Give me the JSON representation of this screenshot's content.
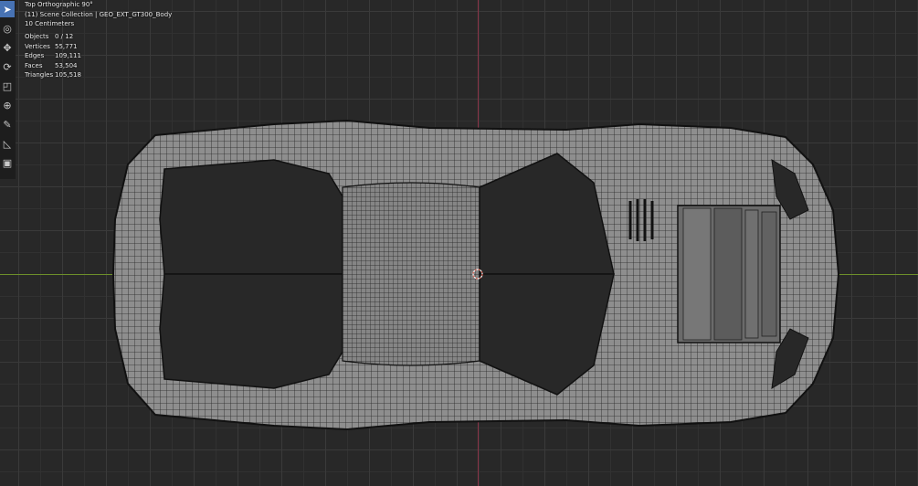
{
  "viewport": {
    "view_name": "Top Orthographic 90°",
    "collection": "(11) Scene Collection | GEO_EXT_GT300_Body",
    "scale": "10 Centimeters"
  },
  "stats": [
    {
      "label": "Objects",
      "value": "0 / 12"
    },
    {
      "label": "Vertices",
      "value": "55,771"
    },
    {
      "label": "Edges",
      "value": "109,111"
    },
    {
      "label": "Faces",
      "value": "53,504"
    },
    {
      "label": "Triangles",
      "value": "105,518"
    }
  ],
  "toolbar": [
    {
      "name": "select-tool",
      "icon": "cursor-arrow-icon",
      "glyph": "➤",
      "active": true
    },
    {
      "name": "cursor-tool",
      "icon": "3d-cursor-icon",
      "glyph": "◎",
      "active": false
    },
    {
      "name": "move-tool",
      "icon": "move-icon",
      "glyph": "✥",
      "active": false
    },
    {
      "name": "rotate-tool",
      "icon": "rotate-icon",
      "glyph": "⟳",
      "active": false
    },
    {
      "name": "scale-tool",
      "icon": "scale-icon",
      "glyph": "◰",
      "active": false
    },
    {
      "name": "transform-tool",
      "icon": "transform-icon",
      "glyph": "⊕",
      "active": false
    },
    {
      "name": "annotate-tool",
      "icon": "pencil-icon",
      "glyph": "✎",
      "active": false
    },
    {
      "name": "measure-tool",
      "icon": "ruler-icon",
      "glyph": "◺",
      "active": false
    },
    {
      "name": "add-cube-tool",
      "icon": "cube-icon",
      "glyph": "▣",
      "active": false
    }
  ],
  "colors": {
    "background": "#282828",
    "grid": "#3a3a3a",
    "x_axis": "#6d8f2a",
    "y_axis": "#8a3448",
    "mesh_fill": "#8c8c8c",
    "mesh_wire": "#1a1a1a",
    "active_tool": "#4772b3"
  }
}
